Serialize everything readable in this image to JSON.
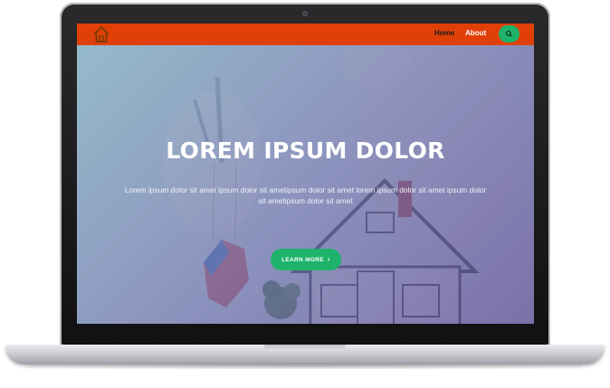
{
  "nav": {
    "home_label": "Home",
    "about_label": "About",
    "logo_icon": "house-icon",
    "search_icon": "search-icon",
    "bar_color": "#e04008",
    "accent_color": "#1db36a"
  },
  "hero": {
    "title": "LOREM IPSUM DOLOR",
    "text": "Lorem ipsum dolor sit amet ipsum dolor sit ametipsum dolor sit amet lorem ipsum dolor sit amet ipsum dolor sit ametipsum dolor sit amet",
    "cta_label": "LEARN MORE",
    "cta_icon": "chevron-right-icon",
    "overlay_color": "#6e78af"
  }
}
